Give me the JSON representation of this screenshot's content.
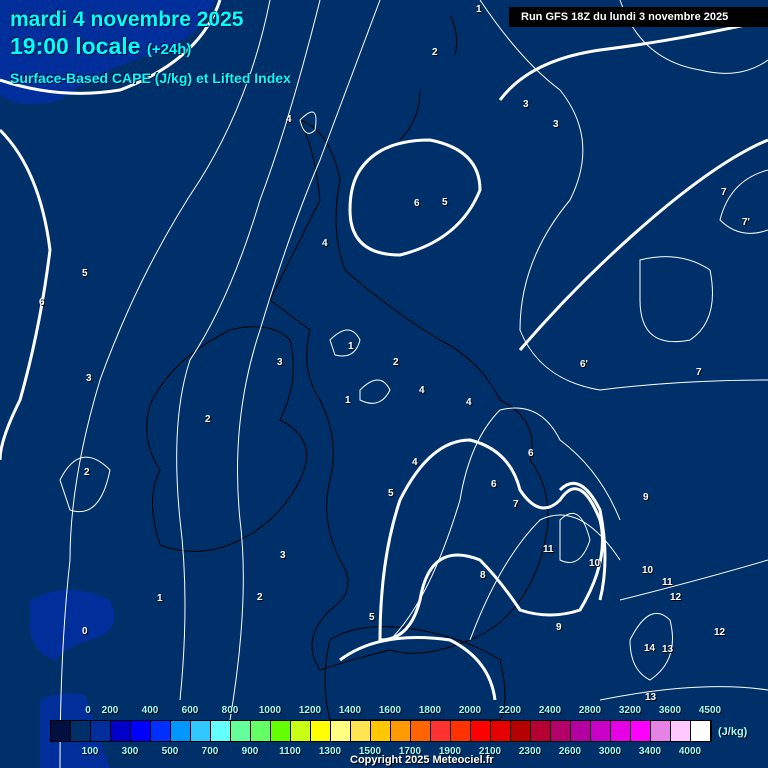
{
  "header": {
    "date": "mardi 4 novembre 2025",
    "time": "19:00 locale",
    "lead": "(+24h)",
    "parameter": "Surface-Based CAPE (J/kg) et Lifted Index",
    "run": "Run GFS 18Z du lundi 3 novembre 2025"
  },
  "contour_labels": [
    "1",
    "2",
    "3",
    "3",
    "4",
    "4",
    "5",
    "6",
    "6",
    "5",
    "7",
    "7'",
    "5",
    "6",
    "3",
    "1",
    "2",
    "2",
    "1",
    "3",
    "2",
    "4",
    "4",
    "6",
    "5",
    "6'",
    "7",
    "9",
    "11",
    "10",
    "8",
    "10",
    "11",
    "12",
    "12",
    "9",
    "4",
    "14",
    "13",
    "13",
    "3",
    "2",
    "1",
    "0",
    "7",
    "7"
  ],
  "legend": {
    "unit": "(J/kg)",
    "top_labels": [
      "0",
      "200",
      "400",
      "600",
      "800",
      "1000",
      "1200",
      "1400",
      "1600",
      "1800",
      "2000",
      "2200",
      "2400",
      "2800",
      "3200",
      "3600",
      "4500"
    ],
    "bottom_labels": [
      "100",
      "300",
      "500",
      "700",
      "900",
      "1100",
      "1300",
      "1500",
      "1700",
      "1900",
      "2100",
      "2300",
      "2600",
      "3000",
      "3400",
      "4000"
    ],
    "colors": [
      "#001040",
      "#00306a",
      "#002e9a",
      "#0000c8",
      "#0000ff",
      "#0030ff",
      "#0096ff",
      "#30c8ff",
      "#64ffff",
      "#64ff9a",
      "#64ff64",
      "#64ff00",
      "#c8ff14",
      "#ffff00",
      "#ffff82",
      "#ffe650",
      "#ffc800",
      "#ff9a00",
      "#ff6400",
      "#ff3232",
      "#ff3200",
      "#ff0000",
      "#e60000",
      "#b40000",
      "#b40032",
      "#b4006a",
      "#b400a0",
      "#c800c8",
      "#e600e6",
      "#ff00ff",
      "#e682e6",
      "#ffc8ff",
      "#ffffff"
    ]
  },
  "copyright": "Copyright 2025 Meteociel.fr"
}
